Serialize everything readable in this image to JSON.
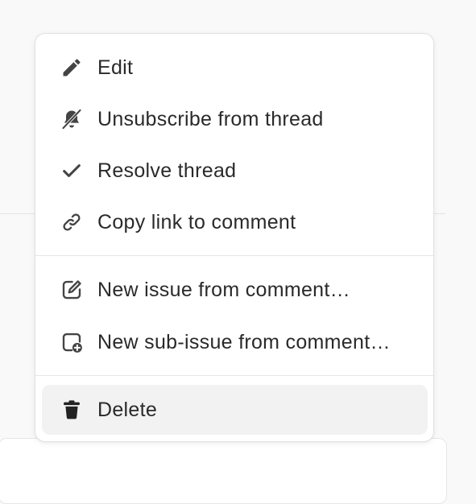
{
  "menu": {
    "items": [
      {
        "label": "Edit",
        "icon": "pencil-icon"
      },
      {
        "label": "Unsubscribe from thread",
        "icon": "bell-off-icon"
      },
      {
        "label": "Resolve thread",
        "icon": "checkmark-icon"
      },
      {
        "label": "Copy link to comment",
        "icon": "link-icon"
      },
      {
        "label": "New issue from comment…",
        "icon": "new-issue-icon"
      },
      {
        "label": "New sub-issue from comment…",
        "icon": "new-sub-issue-icon"
      },
      {
        "label": "Delete",
        "icon": "trash-icon"
      }
    ],
    "highlighted_item": "Delete"
  },
  "colors": {
    "text": "#2a2a2a",
    "icon": "#444444",
    "highlight": "#f2f2f2",
    "separator": "#e6e6e6"
  }
}
